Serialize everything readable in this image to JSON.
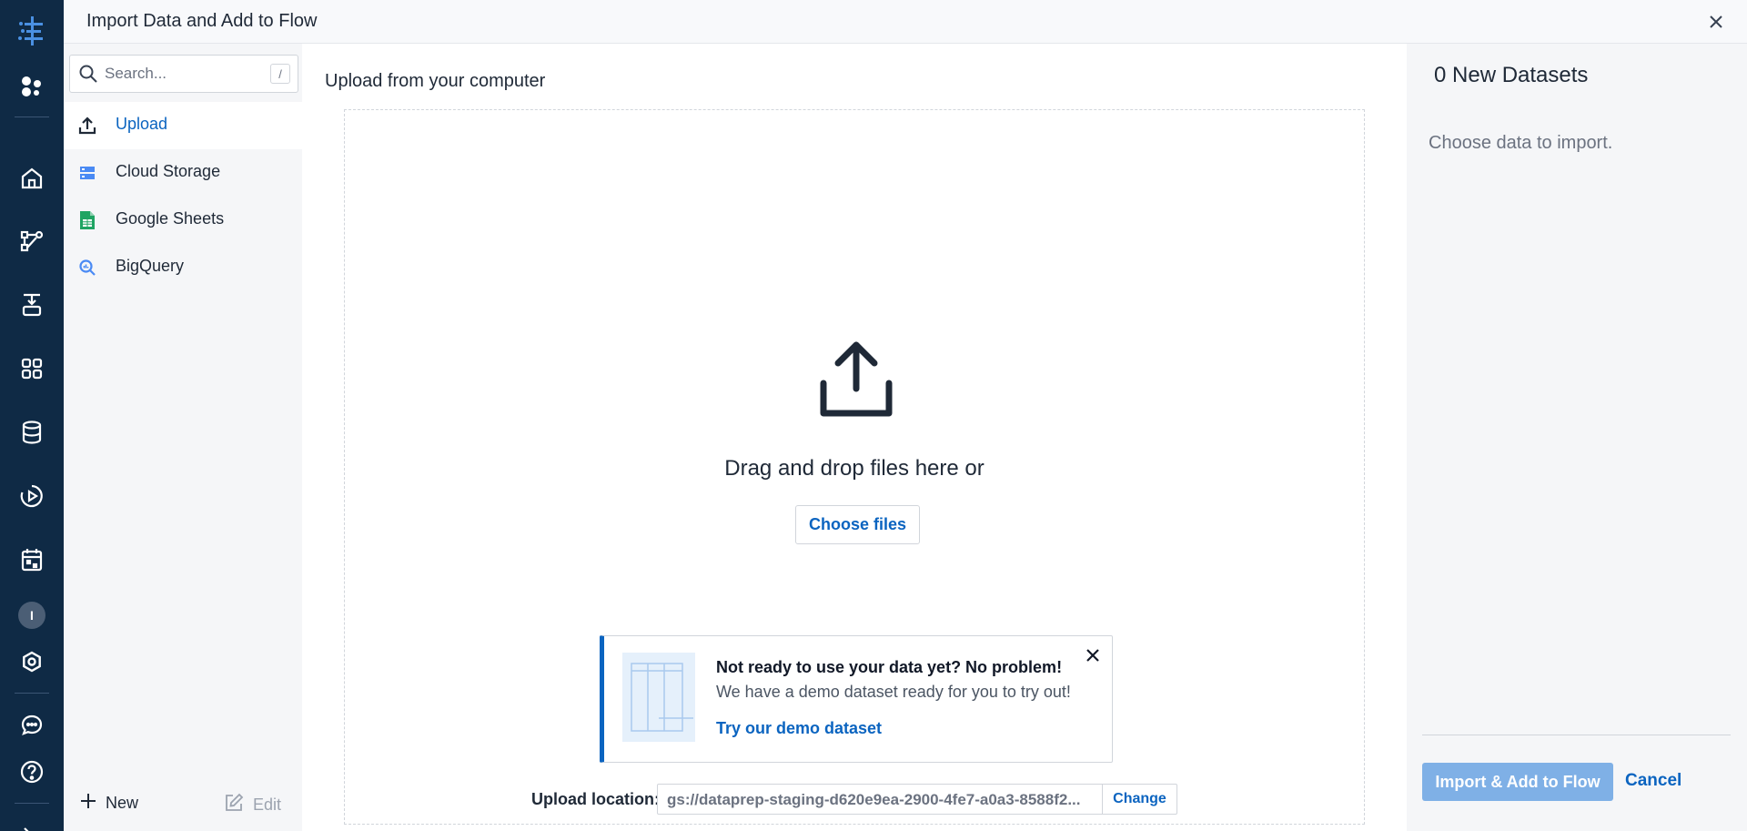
{
  "header": {
    "title": "Import Data and Add to Flow"
  },
  "rail": {
    "icons": [
      "app-logo-icon",
      "products-icon",
      "home-icon",
      "flows-icon",
      "plans-icon",
      "library-icon",
      "connections-icon",
      "jobs-icon",
      "schedules-icon",
      "settings-icon",
      "messages-icon",
      "help-icon",
      "collapse-icon"
    ],
    "avatar_initial": "I"
  },
  "sidebar": {
    "search": {
      "placeholder": "Search...",
      "shortcut": "/"
    },
    "items": [
      {
        "label": "Upload",
        "icon": "upload-icon",
        "active": true
      },
      {
        "label": "Cloud Storage",
        "icon": "cloud-storage-icon",
        "active": false
      },
      {
        "label": "Google Sheets",
        "icon": "google-sheets-icon",
        "active": false
      },
      {
        "label": "BigQuery",
        "icon": "bigquery-icon",
        "active": false
      }
    ],
    "new_label": "New",
    "edit_label": "Edit"
  },
  "main": {
    "title": "Upload from your computer",
    "drag_text": "Drag and drop files here or",
    "choose_label": "Choose files",
    "promo": {
      "title": "Not ready to use your data yet? No problem!",
      "subtitle": "We have a demo dataset ready for you to try out!",
      "link": "Try our demo dataset"
    },
    "upload_location": {
      "label": "Upload location:",
      "path": "gs://dataprep-staging-d620e9ea-2900-4fe7-a0a3-8588f2...",
      "change_label": "Change"
    }
  },
  "right_panel": {
    "title": "0 New Datasets",
    "subtitle": "Choose data to import.",
    "import_label": "Import & Add to Flow",
    "cancel_label": "Cancel"
  },
  "colors": {
    "rail_bg": "#0f2a45",
    "accent": "#0b64c0",
    "import_disabled": "#7fb0e6",
    "panel_bg": "#f5f6f8"
  }
}
